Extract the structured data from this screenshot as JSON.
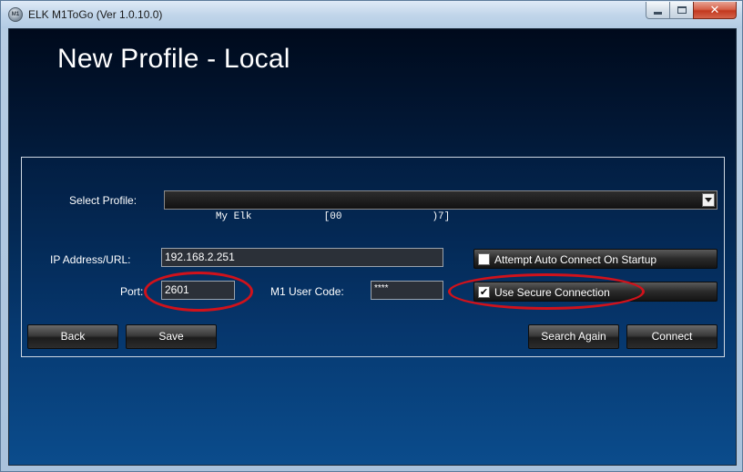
{
  "window": {
    "title": "ELK M1ToGo (Ver 1.0.10.0)",
    "icon": "elk-app-icon",
    "icon_text": "M1"
  },
  "page": {
    "title": "New Profile - Local"
  },
  "form": {
    "select_profile_label": "Select Profile:",
    "select_profile_value": "My Elk            [00               )7]",
    "ip_label": "IP Address/URL:",
    "ip_value": "192.168.2.251",
    "port_label": "Port:",
    "port_value": "2601",
    "user_code_label": "M1 User Code:",
    "user_code_value": "****",
    "auto_connect_label": "Attempt Auto Connect On Startup",
    "auto_connect_checked": "",
    "secure_connection_label": "Use Secure Connection",
    "secure_connection_checked": "✔"
  },
  "buttons": {
    "back": "Back",
    "save": "Save",
    "search_again": "Search Again",
    "connect": "Connect"
  },
  "colors": {
    "annotation": "#d0121b",
    "background_top": "#000a1c",
    "background_bottom": "#0b4c8c"
  }
}
